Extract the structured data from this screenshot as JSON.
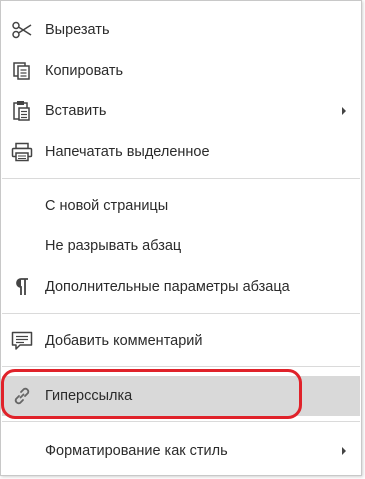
{
  "menu": {
    "items": [
      {
        "label": "Вырезать",
        "icon": "scissors-icon"
      },
      {
        "label": "Копировать",
        "icon": "copy-icon"
      },
      {
        "label": "Вставить",
        "icon": "paste-icon",
        "submenu": true
      },
      {
        "label": "Напечатать выделенное",
        "icon": "printer-icon"
      },
      {
        "label": "С новой страницы"
      },
      {
        "label": "Не разрывать абзац"
      },
      {
        "label": "Дополнительные параметры абзаца",
        "icon": "paragraph-icon"
      },
      {
        "label": "Добавить комментарий",
        "icon": "comment-icon"
      },
      {
        "label": "Гиперссылка",
        "icon": "link-icon",
        "highlighted": true
      },
      {
        "label": "Форматирование как стиль",
        "submenu": true
      }
    ]
  },
  "colors": {
    "highlight_background": "#d9d9d9",
    "callout_border": "#e0222a",
    "separator": "#dadada",
    "text": "#2b2b2b"
  }
}
